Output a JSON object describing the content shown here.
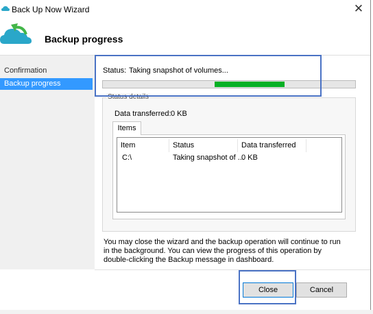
{
  "window": {
    "title": "Back Up Now Wizard",
    "close_glyph": "✕"
  },
  "header": {
    "title": "Backup progress",
    "icon": "cloud-backup-icon"
  },
  "nav": {
    "items": [
      {
        "label": "Confirmation"
      },
      {
        "label": "Backup progress"
      }
    ]
  },
  "status": {
    "label": "Status:",
    "value": "Taking snapshot of volumes...",
    "progress_percent": 44,
    "progress_color": "#06b025"
  },
  "details": {
    "legend": "Status details",
    "data_transferred_label": "Data transferred:",
    "data_transferred_value": "0 KB",
    "tab": "Items",
    "columns": [
      "Item",
      "Status",
      "Data transferred"
    ],
    "rows": [
      {
        "item": "C:\\",
        "status": "Taking snapshot of ...",
        "data": "0 KB"
      }
    ]
  },
  "info": "You may close the wizard and the backup operation will continue to run in the background. You can view the progress of this operation by double-clicking the Backup message in dashboard.",
  "buttons": {
    "close": "Close",
    "cancel": "Cancel"
  },
  "colors": {
    "selection": "#3399ff",
    "highlight_border": "#4a72c4"
  }
}
